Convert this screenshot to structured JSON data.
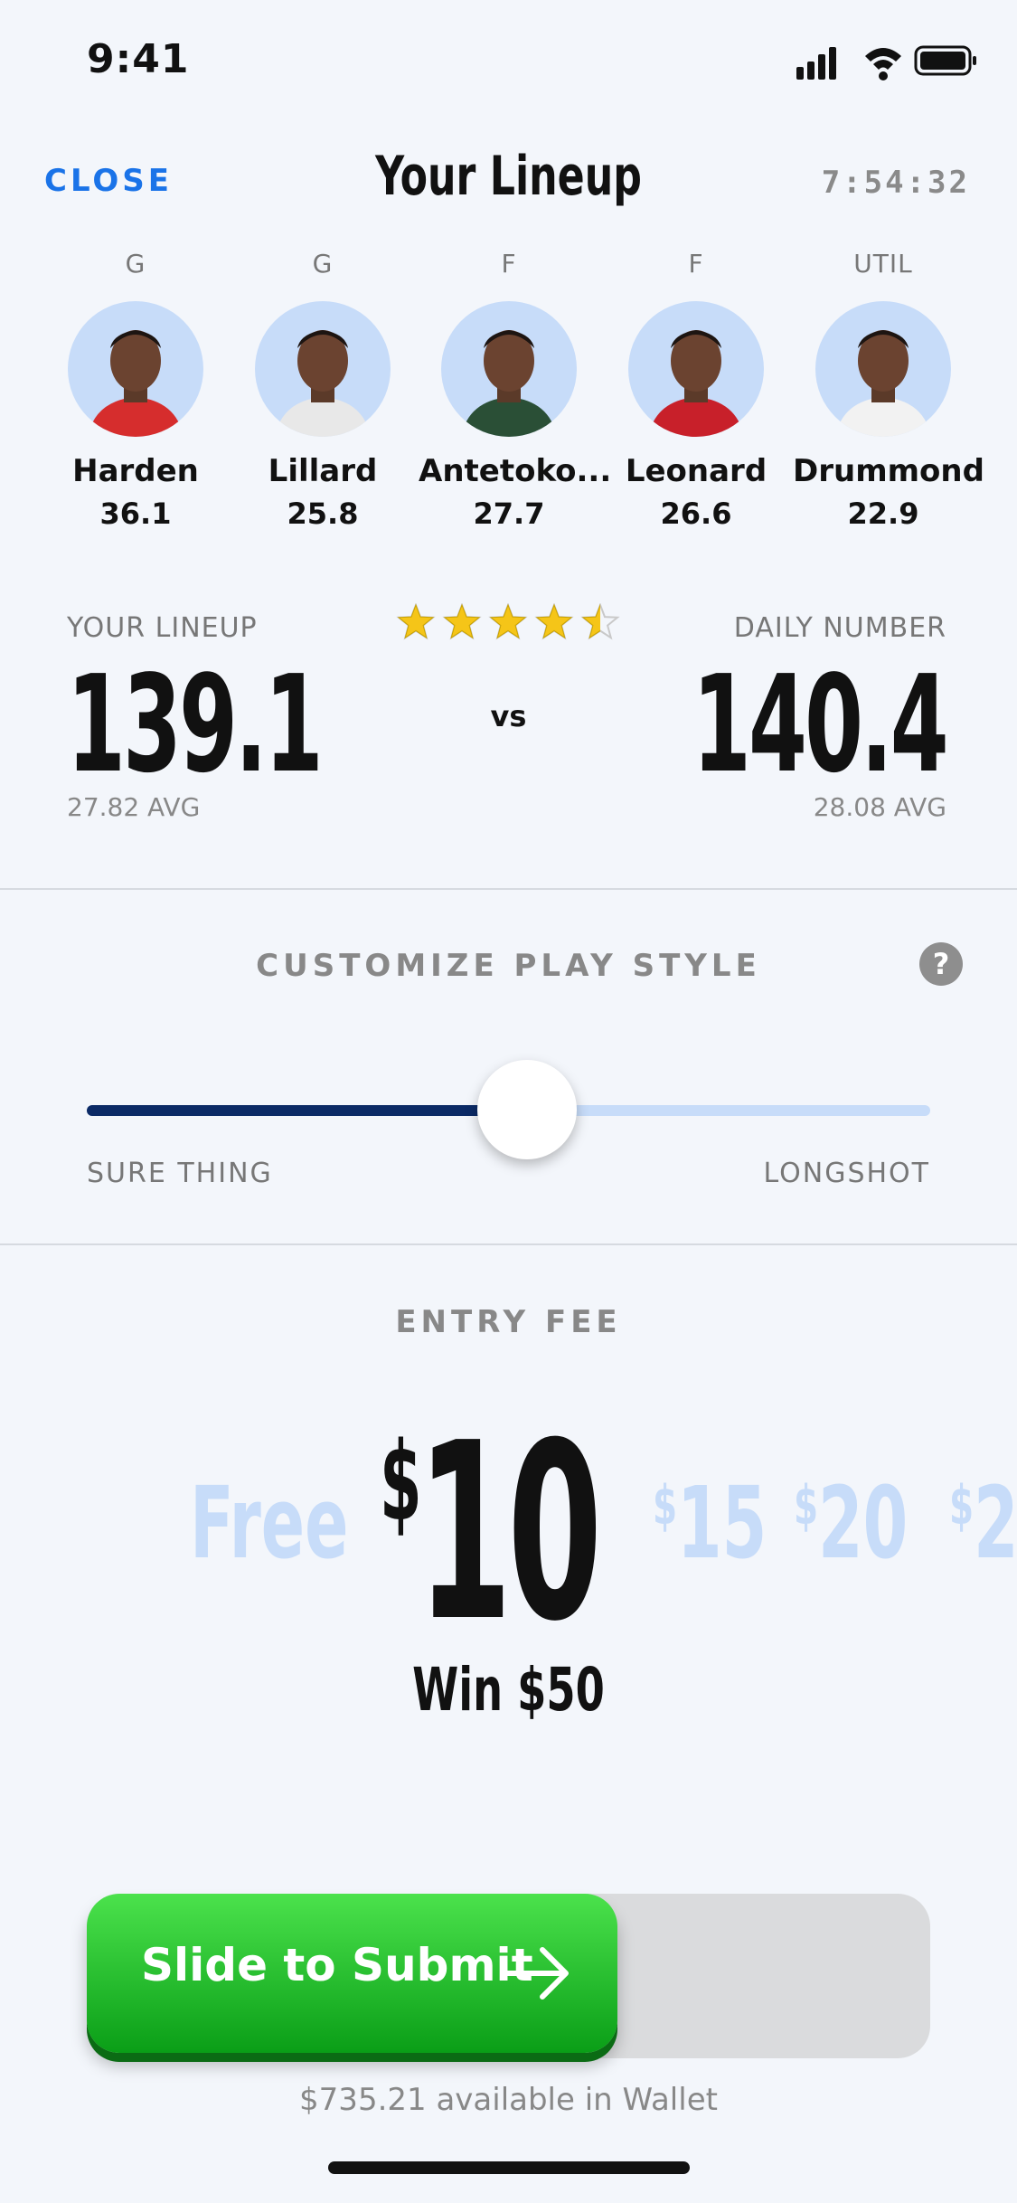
{
  "status_bar": {
    "time": "9:41"
  },
  "header": {
    "close_label": "CLOSE",
    "title": "Your Lineup",
    "timer": "7:54:32"
  },
  "players": [
    {
      "position": "G",
      "name": "Harden",
      "score": "36.1",
      "jersey_color": "#d62d2d"
    },
    {
      "position": "G",
      "name": "Lillard",
      "score": "25.8",
      "jersey_color": "#e8e8e8"
    },
    {
      "position": "F",
      "name": "Antetoko...",
      "score": "27.7",
      "jersey_color": "#2a4f36"
    },
    {
      "position": "F",
      "name": "Leonard",
      "score": "26.6",
      "jersey_color": "#c8202a"
    },
    {
      "position": "UTIL",
      "name": "Drummond",
      "score": "22.9",
      "jersey_color": "#f2f2f2"
    }
  ],
  "comparison": {
    "your_label": "YOUR LINEUP",
    "your_total": "139.1",
    "your_avg": "27.82 AVG",
    "vs_label": "vs",
    "daily_label": "DAILY NUMBER",
    "daily_total": "140.4",
    "daily_avg": "28.08 AVG",
    "rating": 4.5,
    "rating_max": 5
  },
  "play_style": {
    "title": "CUSTOMIZE PLAY STYLE",
    "help_label": "?",
    "left_label": "SURE THING",
    "right_label": "LONGSHOT",
    "value": 0.5
  },
  "entry_fee": {
    "title": "ENTRY FEE",
    "options": [
      "Free",
      "10",
      "15",
      "20",
      "2"
    ],
    "currency": "$",
    "selected": "10",
    "win_text": "Win $50"
  },
  "submit": {
    "label": "Slide to Submit",
    "wallet_text": "$735.21 available in Wallet"
  },
  "colors": {
    "accent": "#1a73e8",
    "slider_fill": "#0b2a66",
    "light_blue": "#c7dcf9",
    "submit_green": "#1fbe2c",
    "star": "#f5c518"
  }
}
